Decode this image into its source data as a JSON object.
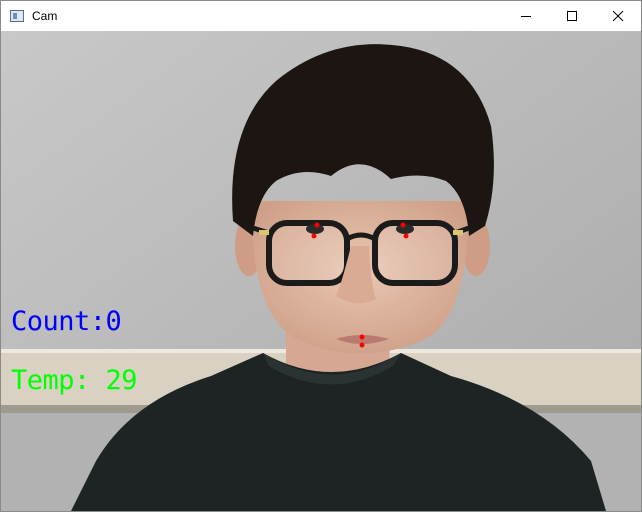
{
  "window": {
    "title": "Cam",
    "icon": "app-window-icon",
    "controls": [
      "minimize-icon",
      "maximize-icon",
      "close-icon"
    ]
  },
  "overlay": {
    "count_text": "Count:0",
    "count_color": "#0000ff",
    "temp_text": "Temp: 29",
    "temp_color": "#00ff00",
    "landmark_color": "#ff0000"
  }
}
